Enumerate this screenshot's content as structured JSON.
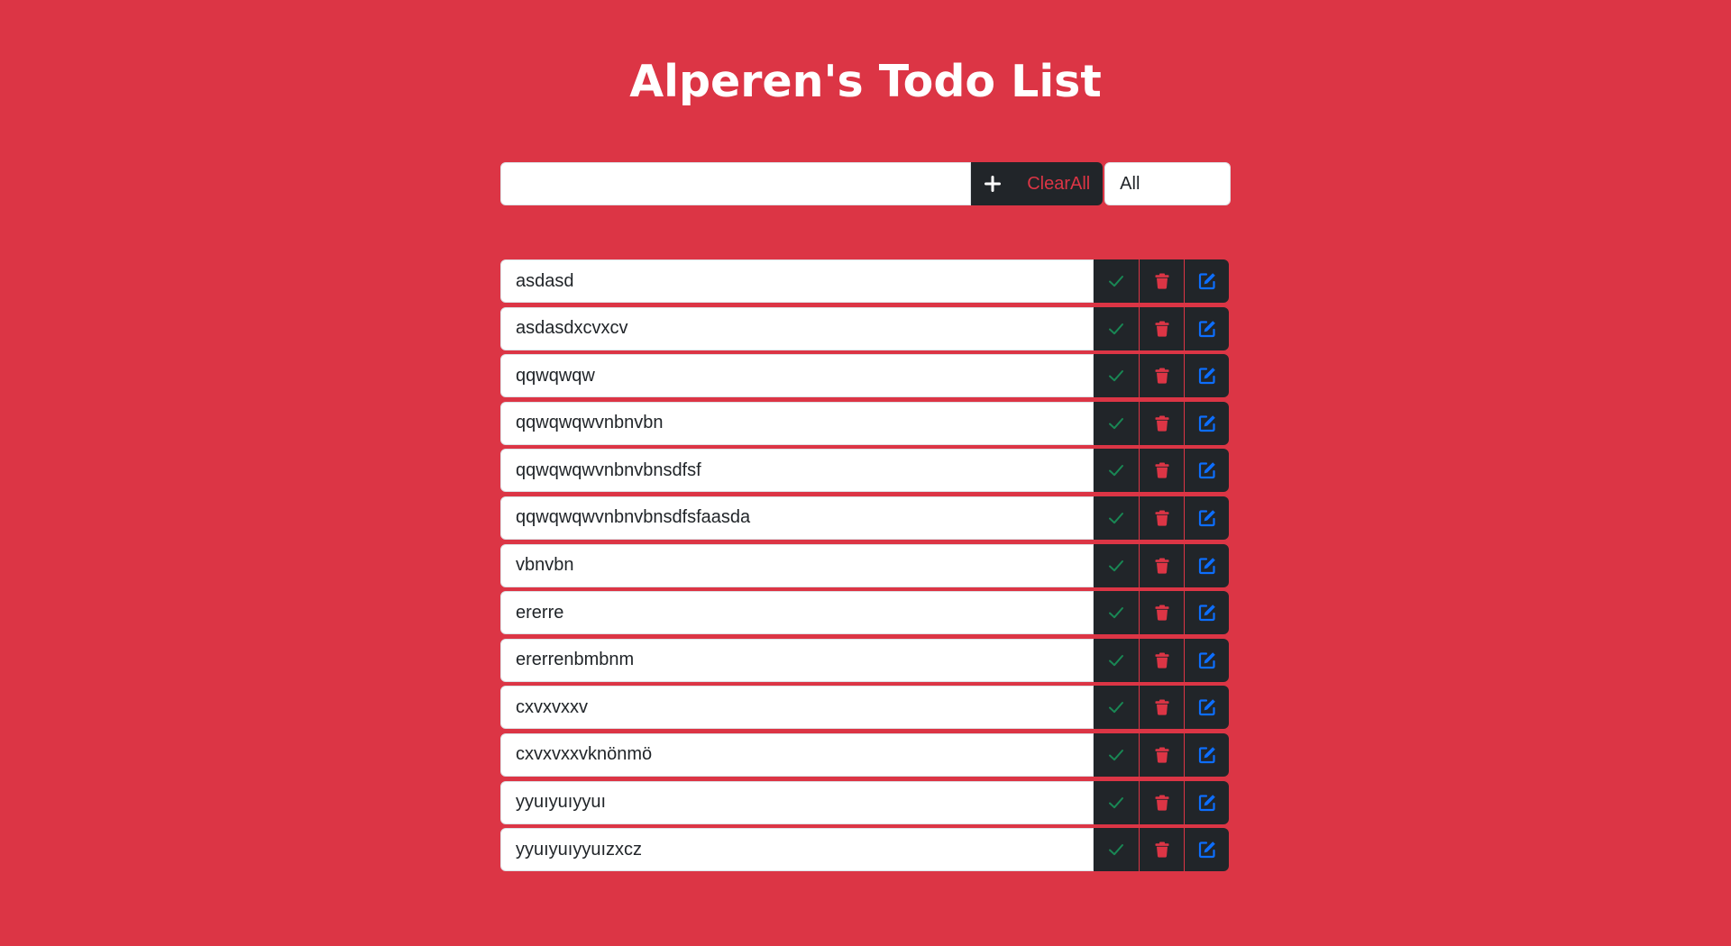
{
  "title": "Alperen's Todo List",
  "toolbar": {
    "input_value": "",
    "add_icon": "plus-icon",
    "clear_label": "ClearAll",
    "filter_value": "All"
  },
  "colors": {
    "background": "#dc3545",
    "dark": "#212529",
    "complete": "#198754",
    "delete": "#dc3545",
    "edit": "#0d6efd"
  },
  "actions": [
    "check-icon",
    "trash-icon",
    "edit-icon"
  ],
  "todos": [
    {
      "text": "asdasd"
    },
    {
      "text": "asdasdxcvxcv"
    },
    {
      "text": "qqwqwqw"
    },
    {
      "text": "qqwqwqwvnbnvbn"
    },
    {
      "text": "qqwqwqwvnbnvbnsdfsf"
    },
    {
      "text": "qqwqwqwvnbnvbnsdfsfaasda"
    },
    {
      "text": "vbnvbn"
    },
    {
      "text": "ererre"
    },
    {
      "text": "ererrenbmbnm"
    },
    {
      "text": "cxvxvxxv"
    },
    {
      "text": "cxvxvxxvknönmö"
    },
    {
      "text": "yyuıyuıyyuı"
    },
    {
      "text": "yyuıyuıyyuızxcz"
    }
  ]
}
